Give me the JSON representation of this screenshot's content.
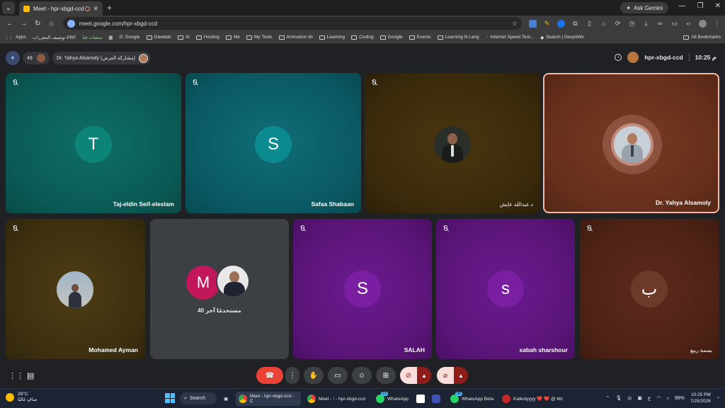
{
  "browser": {
    "tab_title": "Meet - hpr-xbgd-ccd",
    "tab_close": "✕",
    "new_tab": "+",
    "ask_gemini": "Ask Gemini",
    "url": "meet.google.com/hpr-xbgd-ccd",
    "bookmarks": [
      "Apps",
      "توصيف المقررات PRF",
      "منصات قنا",
      "Google",
      "Gawdah",
      "AI",
      "Hosting",
      "Me",
      "My Tools",
      "Animation lib",
      "Learning",
      "Coding",
      "Google",
      "Events",
      "Learning N Lang",
      "Internet Speed Test...",
      "Search | DeepWiki"
    ],
    "all_bookmarks": "All Bookmarks"
  },
  "meet": {
    "participant_count": "49",
    "presenter_label": "Dr. Yahya Alsamoly (مشاركة العرض)",
    "meeting_code": "hpr-xbgd-ccd",
    "clock": "10:25 م",
    "tiles_row1": [
      {
        "name": "Taj-eldin Seif-eleslam",
        "type": "letter",
        "letter": "T",
        "color": "#0c8478"
      },
      {
        "name": "Safaa Shabaan",
        "type": "letter",
        "letter": "S",
        "color": "#0b8a8f"
      },
      {
        "name": "د.عبدالله عايش",
        "type": "photo"
      },
      {
        "name": "Dr. Yahya Alsamoly",
        "type": "photo",
        "speaking": true
      }
    ],
    "tiles_row2": [
      {
        "name": "Mohamed Ayman",
        "type": "photo"
      },
      {
        "name": "",
        "type": "others",
        "letter": "M",
        "others_text": "40 مستخدمًا آخر"
      },
      {
        "name": "SALAH",
        "type": "letter",
        "letter": "S",
        "color": "#7b1fa2"
      },
      {
        "name": "sabah sharshour",
        "type": "letter",
        "letter": "s",
        "color": "#7b1fa2"
      },
      {
        "name": "بسمة ربيع",
        "type": "letter",
        "letter": "ب",
        "color": "#6d3a2a"
      }
    ]
  },
  "taskbar": {
    "weather_temp": "28°C",
    "weather_desc": "صافٍ غالبًا",
    "search_label": "Search",
    "apps": [
      {
        "label": "Meet - hpr-xbgd-ccd - C"
      },
      {
        "label": "Meet - ؛ - hpr-xbgd-ccd"
      },
      {
        "label": "WhatsApp",
        "badge": "23"
      },
      {
        "label": "WhatsApp Beta",
        "badge": "90"
      },
      {
        "label": "Katkotyyyy ❤️ ❤️ @ Mc"
      }
    ],
    "battery": "99%",
    "time": "10:25 PM",
    "date": "7/25/2026",
    "lang": "ع"
  },
  "colors": {
    "end_call": "#ea4335",
    "muted_bg": "#f9dedc",
    "speaking_border": "#f7b9a5"
  }
}
